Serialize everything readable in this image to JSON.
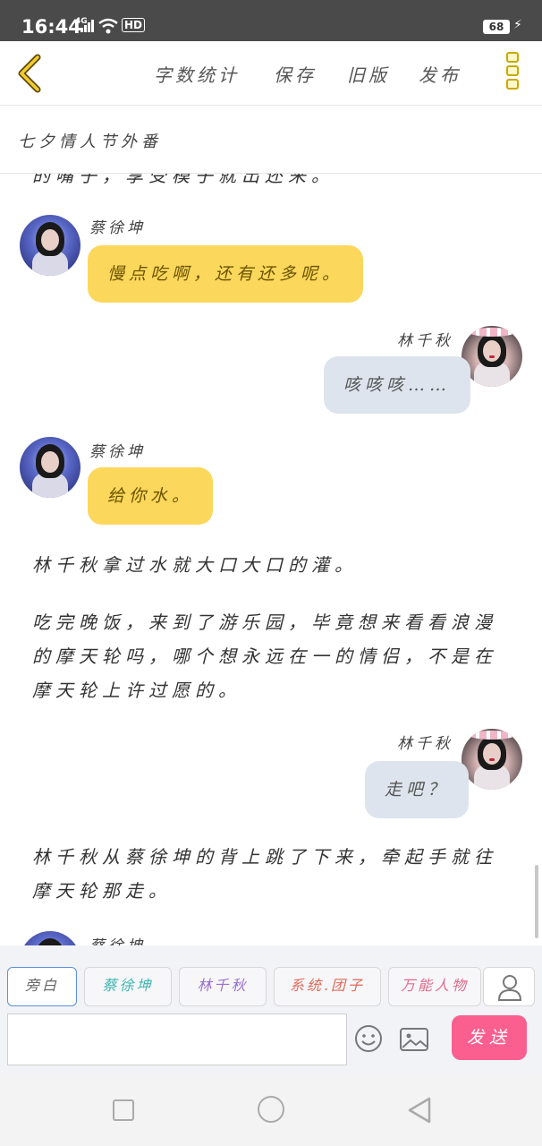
{
  "status_bar": {
    "time": "16:44",
    "network": "4G",
    "hd": "HD",
    "battery": "68"
  },
  "toolbar": {
    "word_count": "字数统计",
    "save": "保存",
    "old_version": "旧版",
    "publish": "发布"
  },
  "chapter_title": "七夕情人节外番",
  "content": {
    "cut_text": "的嘴子，享受模子就出还来。",
    "messages": [
      {
        "speaker": "蔡徐坤",
        "text": "慢点吃啊，还有还多呢。"
      },
      {
        "speaker": "林千秋",
        "text": "咳咳咳……"
      },
      {
        "speaker": "蔡徐坤",
        "text": "给你水。"
      },
      {
        "speaker": "林千秋",
        "text": "走吧？"
      },
      {
        "speaker": "蔡徐坤"
      }
    ],
    "narrations": [
      "林千秋拿过水就大口大口的灌。",
      "吃完晚饭，来到了游乐园，毕竟想来看看浪漫的摩天轮吗，哪个想永远在一的情侣，不是在摩天轮上许过愿的。",
      "林千秋从蔡徐坤的背上跳了下来，牵起手就往摩天轮那走。"
    ]
  },
  "input": {
    "roles": [
      "旁白",
      "蔡徐坤",
      "林千秋",
      "系统.团子",
      "万能人物"
    ],
    "role_colors": [
      "#666666",
      "#3fb6b0",
      "#9a6fd0",
      "#e06a5a",
      "#e06a8a"
    ],
    "text_value": "",
    "send_label": "发送"
  },
  "icons": {
    "back": "chevron-left-icon",
    "more": "more-vertical-icon",
    "person": "person-icon",
    "emoji": "emoji-icon",
    "image": "image-icon"
  },
  "colors": {
    "accent_yellow": "#fbd75b",
    "send_pink": "#fb5f8f",
    "bubble_gray": "#dde4ee"
  }
}
